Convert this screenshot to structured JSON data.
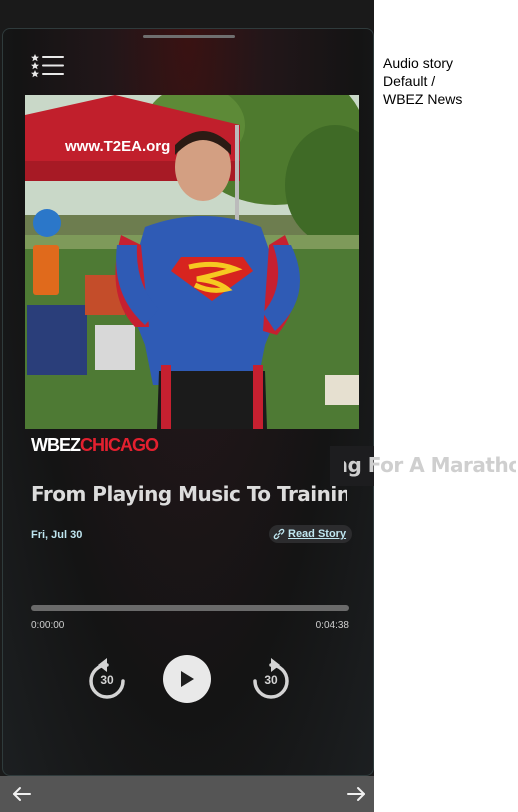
{
  "side_label": {
    "line1": "Audio story",
    "line2": "Default /",
    "line3": "WBEZ News"
  },
  "player": {
    "logo_primary": "WBEZ",
    "logo_secondary": "CHICAGO",
    "title": "From Playing Music To Training For A Marathon",
    "date": "Fri, Jul 30",
    "read_story_label": "Read Story",
    "time_elapsed": "0:00:00",
    "time_total": "0:04:38",
    "progress_fraction": 0,
    "rewind_label": "30",
    "forward_label": "30"
  },
  "artwork": {
    "tent_sign": "www.T2EA.org"
  },
  "colors": {
    "accent": "#e4202f",
    "link": "#bfe6f0",
    "background": "#141414"
  },
  "icons": {
    "menu": "menu-list-icon",
    "link": "link-icon",
    "rewind": "rewind-30-icon",
    "play": "play-icon",
    "forward": "forward-30-icon",
    "nav_back": "arrow-left-icon",
    "nav_forward": "arrow-right-icon"
  }
}
